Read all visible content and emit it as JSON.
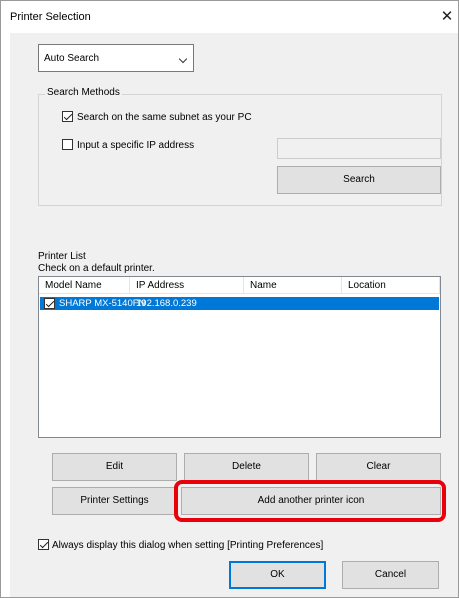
{
  "window": {
    "title": "Printer Selection",
    "close_glyph": "✕"
  },
  "search_mode": {
    "selected": "Auto Search"
  },
  "search_methods": {
    "label": "Search Methods",
    "same_subnet": {
      "label": "Search on the same subnet as your PC",
      "checked": true
    },
    "specific_ip": {
      "label": "Input a specific IP address",
      "checked": false,
      "value": ""
    },
    "search_button": "Search"
  },
  "printer_list": {
    "label": "Printer List",
    "sublabel": "Check on a default printer.",
    "columns": [
      "Model Name",
      "IP Address",
      "Name",
      "Location"
    ],
    "rows": [
      {
        "checked": true,
        "model": "SHARP MX-5140FN",
        "ip": "192.168.0.239",
        "name": "",
        "location": "",
        "selected": true
      }
    ]
  },
  "buttons": {
    "edit": "Edit",
    "delete": "Delete",
    "clear": "Clear",
    "printer_settings": "Printer Settings",
    "add_icon": "Add another printer icon",
    "ok": "OK",
    "cancel": "Cancel"
  },
  "always_display": {
    "label": "Always display this dialog when setting [Printing Preferences]",
    "checked": true
  },
  "colors": {
    "selection": "#0078d7",
    "highlight": "#e8000b",
    "dialog_bg": "#f0f0f0"
  }
}
